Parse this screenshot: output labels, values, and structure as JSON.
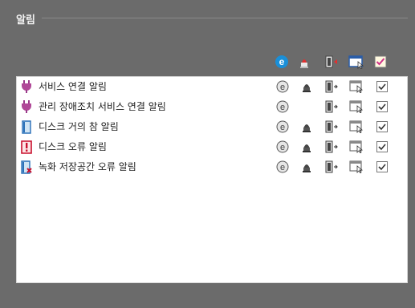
{
  "group": {
    "title": "알림"
  },
  "columns": [
    {
      "name": "ie-icon"
    },
    {
      "name": "siren-icon"
    },
    {
      "name": "door-icon"
    },
    {
      "name": "window-icon"
    },
    {
      "name": "checkbox-icon"
    }
  ],
  "rows": [
    {
      "icon": "plug-icon",
      "label": "서비스 연결 알림",
      "cols": [
        true,
        true,
        true,
        true,
        true
      ]
    },
    {
      "icon": "plug-icon",
      "label": "관리 장애조치 서비스 연결 알림",
      "cols": [
        true,
        false,
        true,
        true,
        true
      ]
    },
    {
      "icon": "disk-icon",
      "label": "디스크 거의 참 알림",
      "cols": [
        true,
        true,
        true,
        true,
        true
      ]
    },
    {
      "icon": "disk-error-icon",
      "label": "디스크 오류 알림",
      "cols": [
        true,
        true,
        true,
        true,
        true
      ]
    },
    {
      "icon": "record-storage-error-icon",
      "label": "녹화 저장공간 오류 알림",
      "cols": [
        true,
        true,
        true,
        true,
        true
      ]
    }
  ],
  "colors": {
    "ie_blue": "#1a8fd8",
    "siren_red": "#e23030",
    "check_pink": "#d0308a",
    "bg": "#6b6b6b"
  }
}
